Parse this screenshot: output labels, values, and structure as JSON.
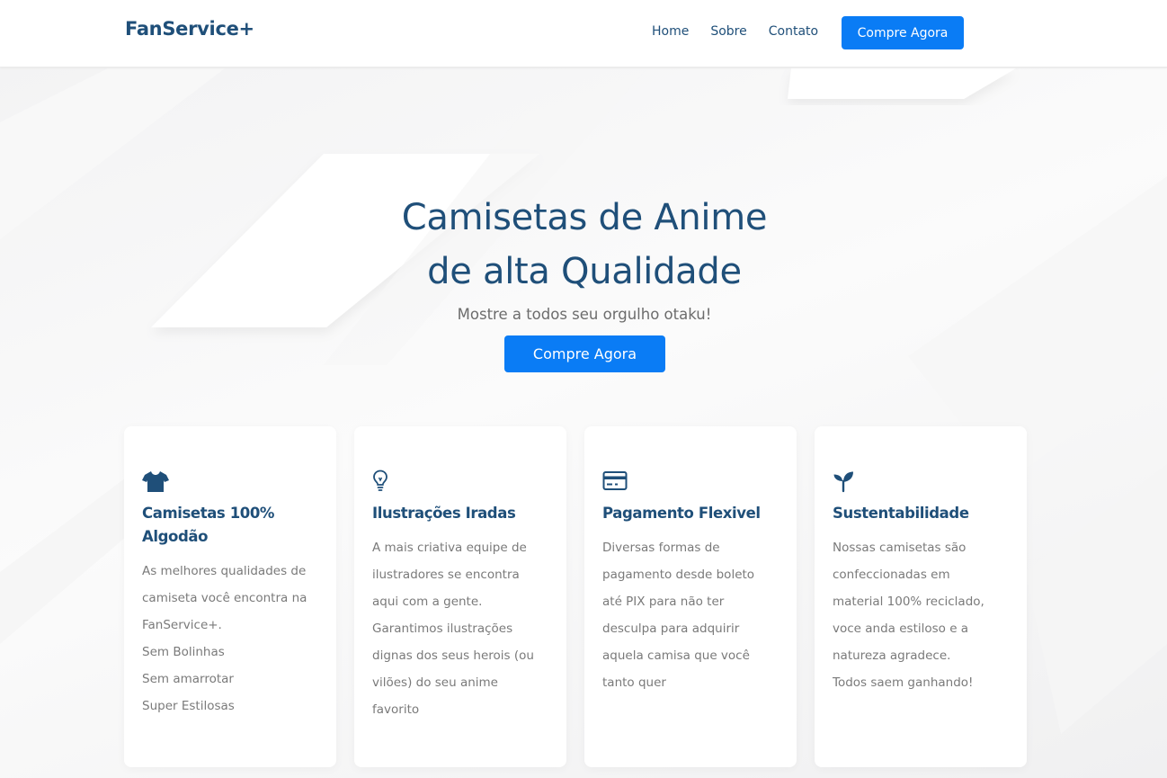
{
  "header": {
    "brand": "FanService+",
    "nav": [
      "Home",
      "Sobre",
      "Contato"
    ],
    "cta_label": "Compre Agora"
  },
  "hero": {
    "title_line1": "Camisetas de Anime",
    "title_line2": "de alta Qualidade",
    "subtitle": "Mostre a todos seu orgulho otaku!",
    "cta_label": "Compre Agora"
  },
  "features": [
    {
      "icon": "tshirt-icon",
      "title_lines": [
        "Camisetas 100%",
        "Algodão"
      ],
      "lines": [
        "As melhores qualidades de",
        "camiseta você encontra na",
        "FanService+.",
        "Sem Bolinhas",
        "Sem amarrotar",
        "Super Estilosas"
      ]
    },
    {
      "icon": "lightbulb-icon",
      "title_lines": [
        "Ilustrações Iradas"
      ],
      "lines": [
        "A mais criativa equipe de",
        "ilustradores se encontra",
        "aqui com a gente.",
        "Garantimos ilustrações",
        "dignas dos seus herois (ou",
        "vilões) do seu anime",
        "favorito"
      ]
    },
    {
      "icon": "credit-card-icon",
      "title_lines": [
        "Pagamento Flexivel"
      ],
      "lines": [
        "Diversas formas de",
        "pagamento desde boleto",
        "até PIX para não ter",
        "desculpa para adquirir",
        "aquela camisa que você",
        "tanto quer"
      ]
    },
    {
      "icon": "sprout-icon",
      "title_lines": [
        "Sustentabilidade"
      ],
      "lines": [
        "Nossas camisetas são",
        "confeccionadas em",
        "material 100% reciclado,",
        "voce anda estiloso e a",
        "natureza agradece.",
        "Todos saem ganhando!"
      ]
    }
  ],
  "colors": {
    "accent": "#0a7cf5",
    "heading": "#1f4f79",
    "text": "#7a7a7a"
  }
}
